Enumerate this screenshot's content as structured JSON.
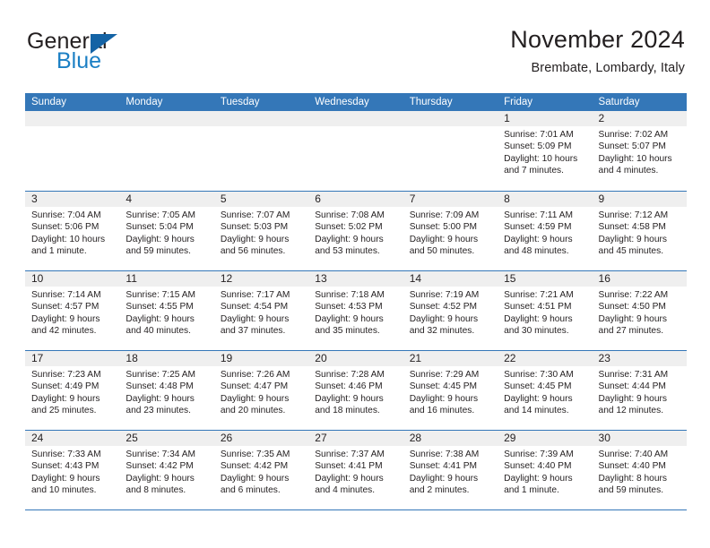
{
  "logo": {
    "word1": "General",
    "word2": "Blue",
    "triangle_color": "#1463a5",
    "blue_color": "#1b7fc4"
  },
  "header": {
    "title": "November 2024",
    "subtitle": "Brembate, Lombardy, Italy"
  },
  "colors": {
    "header_blue": "#3477b8",
    "daynum_band": "#efefef",
    "text": "#231f20"
  },
  "weekdays": [
    "Sunday",
    "Monday",
    "Tuesday",
    "Wednesday",
    "Thursday",
    "Friday",
    "Saturday"
  ],
  "weeks": [
    [
      {
        "day": "",
        "sunrise": "",
        "sunset": "",
        "daylight": "",
        "empty": true
      },
      {
        "day": "",
        "sunrise": "",
        "sunset": "",
        "daylight": "",
        "empty": true
      },
      {
        "day": "",
        "sunrise": "",
        "sunset": "",
        "daylight": "",
        "empty": true
      },
      {
        "day": "",
        "sunrise": "",
        "sunset": "",
        "daylight": "",
        "empty": true
      },
      {
        "day": "",
        "sunrise": "",
        "sunset": "",
        "daylight": "",
        "empty": true
      },
      {
        "day": "1",
        "sunrise": "Sunrise: 7:01 AM",
        "sunset": "Sunset: 5:09 PM",
        "daylight": "Daylight: 10 hours and 7 minutes."
      },
      {
        "day": "2",
        "sunrise": "Sunrise: 7:02 AM",
        "sunset": "Sunset: 5:07 PM",
        "daylight": "Daylight: 10 hours and 4 minutes."
      }
    ],
    [
      {
        "day": "3",
        "sunrise": "Sunrise: 7:04 AM",
        "sunset": "Sunset: 5:06 PM",
        "daylight": "Daylight: 10 hours and 1 minute."
      },
      {
        "day": "4",
        "sunrise": "Sunrise: 7:05 AM",
        "sunset": "Sunset: 5:04 PM",
        "daylight": "Daylight: 9 hours and 59 minutes."
      },
      {
        "day": "5",
        "sunrise": "Sunrise: 7:07 AM",
        "sunset": "Sunset: 5:03 PM",
        "daylight": "Daylight: 9 hours and 56 minutes."
      },
      {
        "day": "6",
        "sunrise": "Sunrise: 7:08 AM",
        "sunset": "Sunset: 5:02 PM",
        "daylight": "Daylight: 9 hours and 53 minutes."
      },
      {
        "day": "7",
        "sunrise": "Sunrise: 7:09 AM",
        "sunset": "Sunset: 5:00 PM",
        "daylight": "Daylight: 9 hours and 50 minutes."
      },
      {
        "day": "8",
        "sunrise": "Sunrise: 7:11 AM",
        "sunset": "Sunset: 4:59 PM",
        "daylight": "Daylight: 9 hours and 48 minutes."
      },
      {
        "day": "9",
        "sunrise": "Sunrise: 7:12 AM",
        "sunset": "Sunset: 4:58 PM",
        "daylight": "Daylight: 9 hours and 45 minutes."
      }
    ],
    [
      {
        "day": "10",
        "sunrise": "Sunrise: 7:14 AM",
        "sunset": "Sunset: 4:57 PM",
        "daylight": "Daylight: 9 hours and 42 minutes."
      },
      {
        "day": "11",
        "sunrise": "Sunrise: 7:15 AM",
        "sunset": "Sunset: 4:55 PM",
        "daylight": "Daylight: 9 hours and 40 minutes."
      },
      {
        "day": "12",
        "sunrise": "Sunrise: 7:17 AM",
        "sunset": "Sunset: 4:54 PM",
        "daylight": "Daylight: 9 hours and 37 minutes."
      },
      {
        "day": "13",
        "sunrise": "Sunrise: 7:18 AM",
        "sunset": "Sunset: 4:53 PM",
        "daylight": "Daylight: 9 hours and 35 minutes."
      },
      {
        "day": "14",
        "sunrise": "Sunrise: 7:19 AM",
        "sunset": "Sunset: 4:52 PM",
        "daylight": "Daylight: 9 hours and 32 minutes."
      },
      {
        "day": "15",
        "sunrise": "Sunrise: 7:21 AM",
        "sunset": "Sunset: 4:51 PM",
        "daylight": "Daylight: 9 hours and 30 minutes."
      },
      {
        "day": "16",
        "sunrise": "Sunrise: 7:22 AM",
        "sunset": "Sunset: 4:50 PM",
        "daylight": "Daylight: 9 hours and 27 minutes."
      }
    ],
    [
      {
        "day": "17",
        "sunrise": "Sunrise: 7:23 AM",
        "sunset": "Sunset: 4:49 PM",
        "daylight": "Daylight: 9 hours and 25 minutes."
      },
      {
        "day": "18",
        "sunrise": "Sunrise: 7:25 AM",
        "sunset": "Sunset: 4:48 PM",
        "daylight": "Daylight: 9 hours and 23 minutes."
      },
      {
        "day": "19",
        "sunrise": "Sunrise: 7:26 AM",
        "sunset": "Sunset: 4:47 PM",
        "daylight": "Daylight: 9 hours and 20 minutes."
      },
      {
        "day": "20",
        "sunrise": "Sunrise: 7:28 AM",
        "sunset": "Sunset: 4:46 PM",
        "daylight": "Daylight: 9 hours and 18 minutes."
      },
      {
        "day": "21",
        "sunrise": "Sunrise: 7:29 AM",
        "sunset": "Sunset: 4:45 PM",
        "daylight": "Daylight: 9 hours and 16 minutes."
      },
      {
        "day": "22",
        "sunrise": "Sunrise: 7:30 AM",
        "sunset": "Sunset: 4:45 PM",
        "daylight": "Daylight: 9 hours and 14 minutes."
      },
      {
        "day": "23",
        "sunrise": "Sunrise: 7:31 AM",
        "sunset": "Sunset: 4:44 PM",
        "daylight": "Daylight: 9 hours and 12 minutes."
      }
    ],
    [
      {
        "day": "24",
        "sunrise": "Sunrise: 7:33 AM",
        "sunset": "Sunset: 4:43 PM",
        "daylight": "Daylight: 9 hours and 10 minutes."
      },
      {
        "day": "25",
        "sunrise": "Sunrise: 7:34 AM",
        "sunset": "Sunset: 4:42 PM",
        "daylight": "Daylight: 9 hours and 8 minutes."
      },
      {
        "day": "26",
        "sunrise": "Sunrise: 7:35 AM",
        "sunset": "Sunset: 4:42 PM",
        "daylight": "Daylight: 9 hours and 6 minutes."
      },
      {
        "day": "27",
        "sunrise": "Sunrise: 7:37 AM",
        "sunset": "Sunset: 4:41 PM",
        "daylight": "Daylight: 9 hours and 4 minutes."
      },
      {
        "day": "28",
        "sunrise": "Sunrise: 7:38 AM",
        "sunset": "Sunset: 4:41 PM",
        "daylight": "Daylight: 9 hours and 2 minutes."
      },
      {
        "day": "29",
        "sunrise": "Sunrise: 7:39 AM",
        "sunset": "Sunset: 4:40 PM",
        "daylight": "Daylight: 9 hours and 1 minute."
      },
      {
        "day": "30",
        "sunrise": "Sunrise: 7:40 AM",
        "sunset": "Sunset: 4:40 PM",
        "daylight": "Daylight: 8 hours and 59 minutes."
      }
    ]
  ]
}
